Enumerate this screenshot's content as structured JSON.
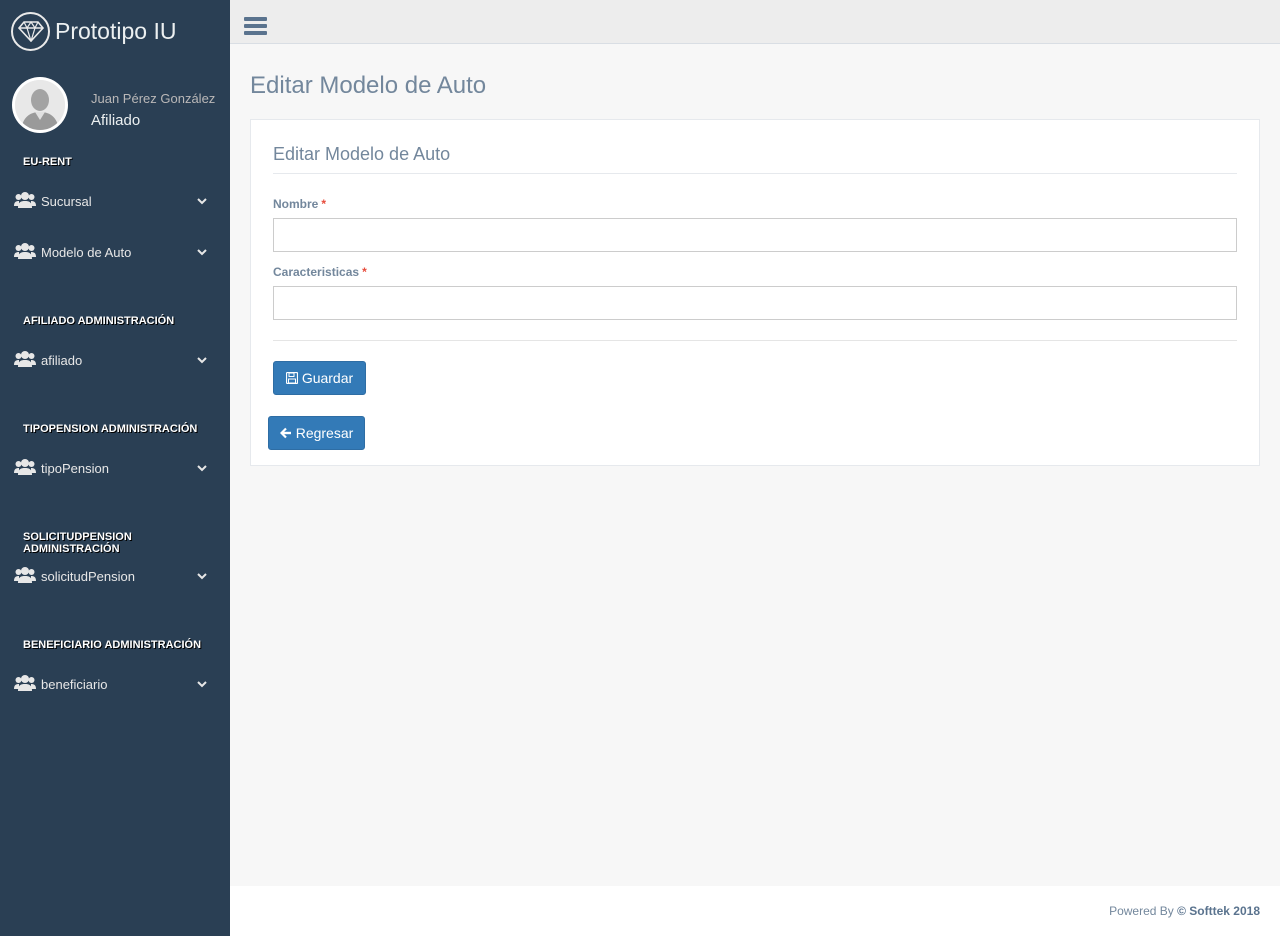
{
  "brand": {
    "title": "Prototipo IU",
    "icon": "diamond-icon"
  },
  "profile": {
    "name": "Juan Pérez González",
    "role": "Afiliado"
  },
  "sidebar": {
    "sections": [
      {
        "title": "EU-RENT",
        "items": [
          {
            "label": "Sucursal",
            "icon": "users-icon"
          },
          {
            "label": "Modelo de Auto",
            "icon": "users-icon"
          }
        ]
      },
      {
        "title": "AFILIADO ADMINISTRACIÓN",
        "items": [
          {
            "label": "afiliado",
            "icon": "users-icon"
          }
        ]
      },
      {
        "title": "TIPOPENSION ADMINISTRACIÓN",
        "items": [
          {
            "label": "tipoPension",
            "icon": "users-icon"
          }
        ]
      },
      {
        "title": "SOLICITUDPENSION ADMINISTRACIÓN",
        "items": [
          {
            "label": "solicitudPension",
            "icon": "users-icon"
          }
        ]
      },
      {
        "title": "BENEFICIARIO ADMINISTRACIÓN",
        "items": [
          {
            "label": "beneficiario",
            "icon": "users-icon"
          }
        ]
      }
    ]
  },
  "main": {
    "page_title": "Editar Modelo de Auto",
    "panel_title": "Editar Modelo de Auto",
    "fields": [
      {
        "label": "Nombre",
        "required_mark": "*",
        "value": ""
      },
      {
        "label": "Caracteristicas",
        "required_mark": "*",
        "value": ""
      }
    ],
    "save_label": "Guardar",
    "back_label": "Regresar"
  },
  "footer": {
    "prefix": "Powered By",
    "brand": "© Softtek 2018"
  },
  "colors": {
    "sidebar_bg": "#2a3f54",
    "primary": "#337ab7",
    "required": "#e74c3c"
  }
}
